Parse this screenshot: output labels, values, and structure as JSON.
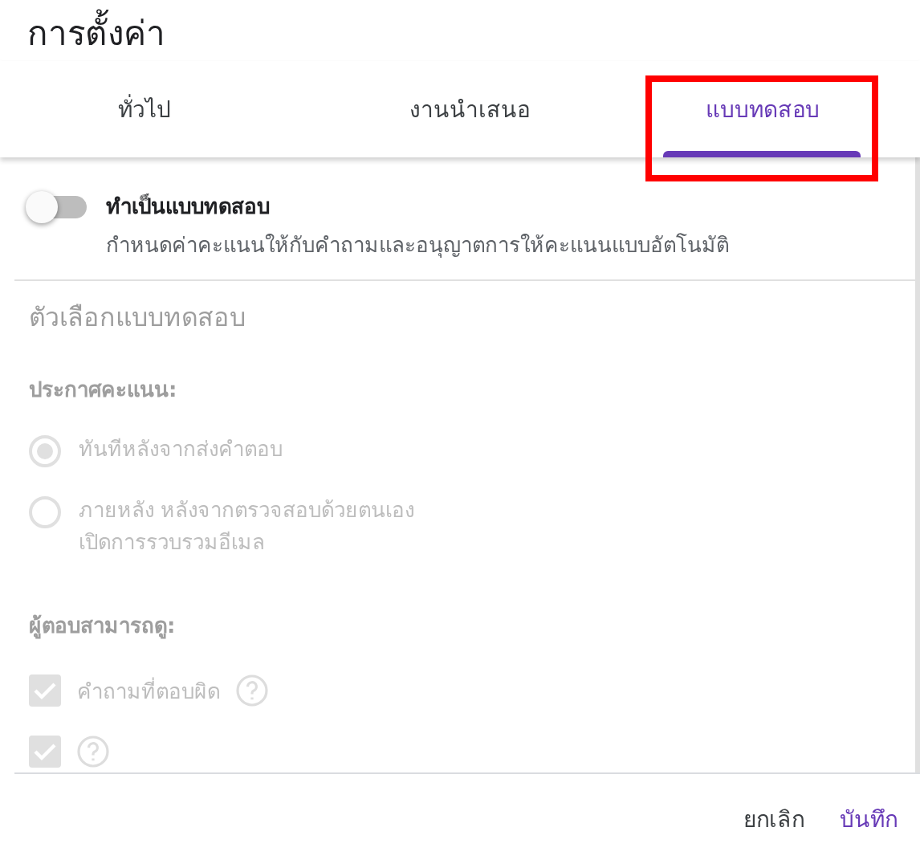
{
  "dialog": {
    "title": "การตั้งค่า"
  },
  "tabs": [
    {
      "label": "ทั่วไป",
      "selected": false
    },
    {
      "label": "งานนำเสนอ",
      "selected": false
    },
    {
      "label": "แบบทดสอบ",
      "selected": true,
      "highlighted": true
    }
  ],
  "quiz_toggle": {
    "label": "ทำเป็นแบบทดสอบ",
    "description": "กำหนดค่าคะแนนให้กับคำถามและอนุญาตการให้คะแนนแบบอัตโนมัติ",
    "on": false
  },
  "quiz_options": {
    "title": "ตัวเลือกแบบทดสอบ",
    "release_grade": {
      "label": "ประกาศคะแนน:",
      "options": [
        {
          "lines": [
            "ทันทีหลังจากส่งคำตอบ"
          ],
          "selected": true
        },
        {
          "lines": [
            "ภายหลัง หลังจากตรวจสอบด้วยตนเอง",
            "เปิดการรวบรวมอีเมล"
          ],
          "selected": false
        }
      ]
    },
    "respondent_can_see": {
      "label": "ผู้ตอบสามารถดู:",
      "items": [
        {
          "label": "คำถามที่ตอบผิด",
          "checked": true
        },
        {
          "checked": true
        }
      ]
    }
  },
  "buttons": [
    {
      "label": "ยกเลิก",
      "kind": "plain"
    },
    {
      "label": "บันทึก",
      "kind": "primary"
    }
  ]
}
